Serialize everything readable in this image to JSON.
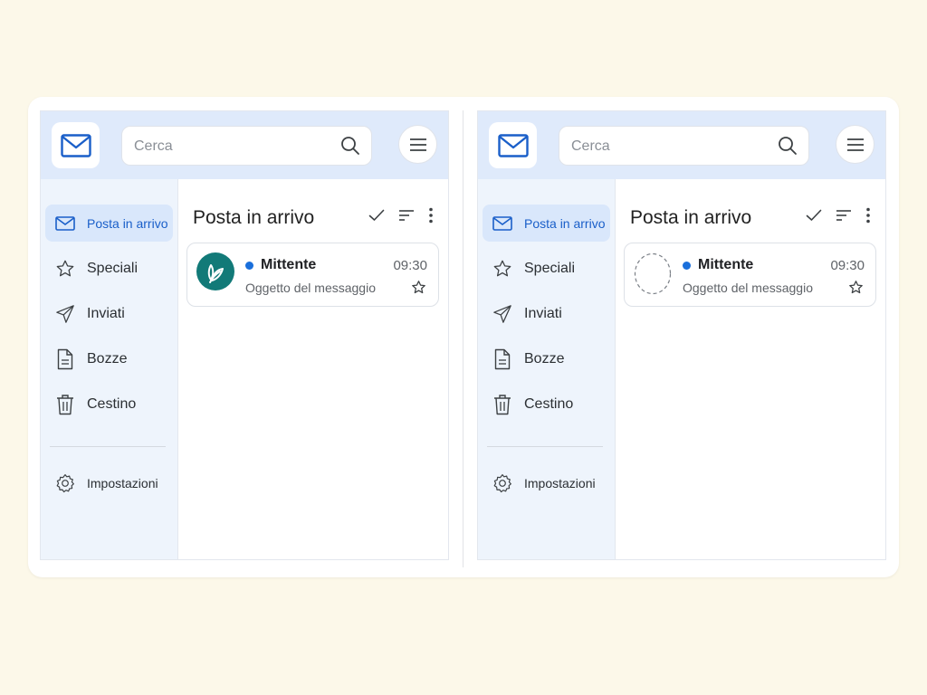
{
  "search": {
    "placeholder": "Cerca"
  },
  "nav": [
    {
      "label": "Posta in arrivo",
      "icon": "mail-icon",
      "active": true
    },
    {
      "label": "Speciali",
      "icon": "star-icon"
    },
    {
      "label": "Inviati",
      "icon": "send-icon"
    },
    {
      "label": "Bozze",
      "icon": "draft-icon"
    },
    {
      "label": "Cestino",
      "icon": "trash-icon"
    }
  ],
  "settings": {
    "label": "Impostazioni",
    "icon": "gear-icon"
  },
  "inbox": {
    "title": "Posta in arrivo"
  },
  "message": {
    "sender": "Mittente",
    "time": "09:30",
    "subject": "Oggetto del messaggio"
  },
  "colors": {
    "accent": "#1a5fc9",
    "header_bg": "#dfeafb",
    "avatar_bg": "#127a78",
    "unread_dot": "#1a6fdb",
    "page_bg": "#fcf8e9"
  },
  "variants": [
    {
      "name": "left",
      "avatar": "leaf-logo-avatar"
    },
    {
      "name": "right",
      "avatar": "empty-dashed-placeholder"
    }
  ]
}
